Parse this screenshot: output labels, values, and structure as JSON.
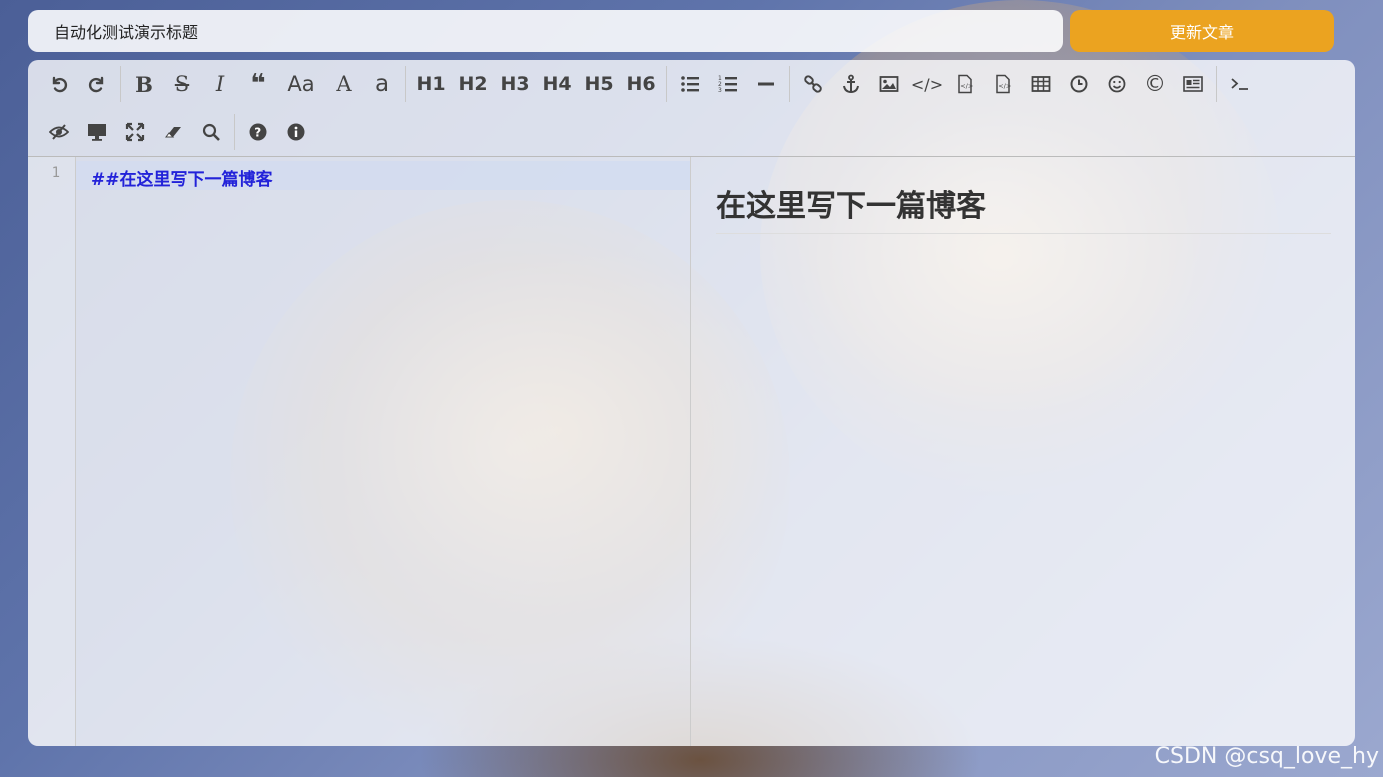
{
  "title_input": {
    "value": "自动化测试演示标题"
  },
  "update_button": {
    "label": "更新文章"
  },
  "toolbar": {
    "row1": [
      {
        "name": "undo-icon",
        "glyph": "↶"
      },
      {
        "name": "redo-icon",
        "glyph": "↷"
      },
      {
        "name": "bold-icon",
        "glyph": "B"
      },
      {
        "name": "strikethrough-icon",
        "glyph": "S"
      },
      {
        "name": "italic-icon",
        "glyph": "I"
      },
      {
        "name": "quote-icon",
        "glyph": "❝"
      },
      {
        "name": "uppercase-toggle-icon",
        "glyph": "Aa"
      },
      {
        "name": "uppercase-icon",
        "glyph": "A"
      },
      {
        "name": "lowercase-icon",
        "glyph": "a"
      },
      {
        "name": "h1-button",
        "glyph": "H1"
      },
      {
        "name": "h2-button",
        "glyph": "H2"
      },
      {
        "name": "h3-button",
        "glyph": "H3"
      },
      {
        "name": "h4-button",
        "glyph": "H4"
      },
      {
        "name": "h5-button",
        "glyph": "H5"
      },
      {
        "name": "h6-button",
        "glyph": "H6"
      }
    ],
    "row2": []
  },
  "editor": {
    "line_number": "1",
    "code_line": "##在这里写下一篇博客"
  },
  "preview": {
    "heading": "在这里写下一篇博客"
  },
  "watermark": "CSDN @csq_love_hy",
  "colors": {
    "accent": "#eba320",
    "code_text": "#2222d9",
    "heading_text": "#333333"
  }
}
